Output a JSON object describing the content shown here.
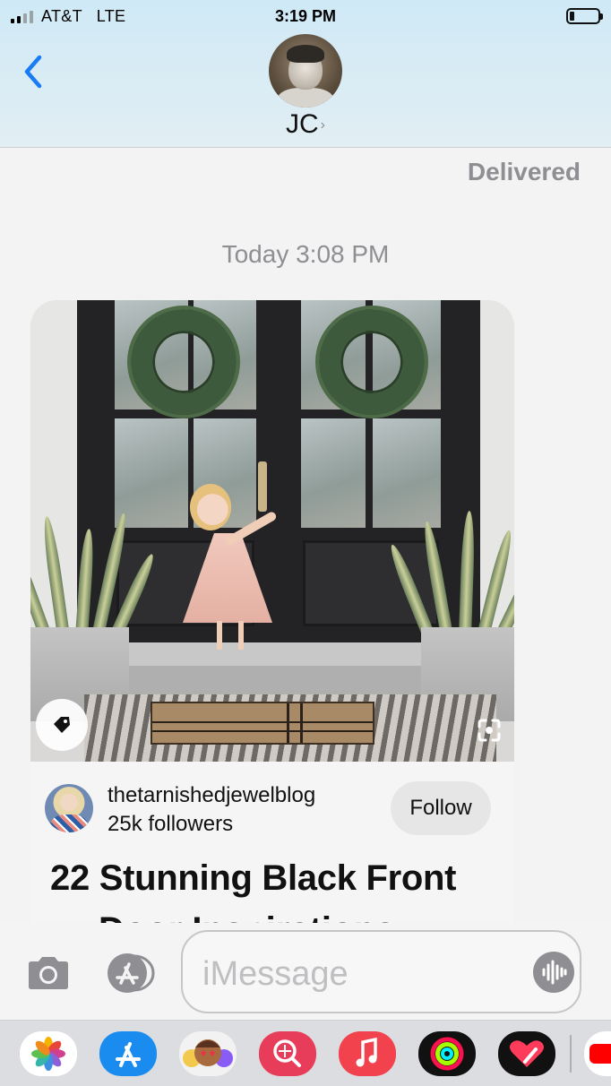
{
  "status_bar": {
    "carrier": "AT&T",
    "network": "LTE",
    "time": "3:19 PM",
    "battery_level": 0.15,
    "signal_bars": 4,
    "signal_active": 2
  },
  "header": {
    "contact_name": "JC",
    "chevron": "›",
    "back_icon": "chevron-left-icon"
  },
  "thread": {
    "delivered_label": "Delivered",
    "timestamp_day": "Today",
    "timestamp_time": "3:08 PM"
  },
  "pin_card": {
    "author": "thetarnishedjewelblog",
    "followers": "25k followers",
    "follow_label": "Follow",
    "title_line1": "22 Stunning Black Front",
    "title_line2": "Door Inspirations",
    "icons": [
      "tag-icon",
      "visual-search-icon"
    ]
  },
  "compose": {
    "placeholder": "iMessage",
    "icons": [
      "camera-icon",
      "app-store-icon",
      "audio-message-icon"
    ]
  },
  "app_drawer": {
    "apps": [
      "photos-app",
      "app-store-app",
      "memoji-app",
      "image-search-app",
      "music-app",
      "activity-app",
      "digital-touch-app",
      "youtube-app"
    ]
  },
  "colors": {
    "accent": "#1a7cf5",
    "header_bg": "#d6ebf4",
    "gray_text": "#8e8e93"
  }
}
